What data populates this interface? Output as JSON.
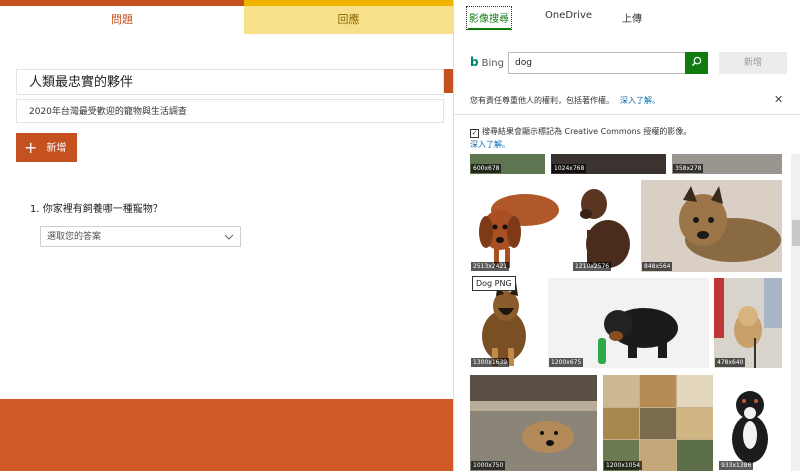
{
  "form": {
    "tabs": {
      "questions": "問題",
      "responses": "回應"
    },
    "title": "人類最忠實的夥伴",
    "subtitle": "2020年台灣最受歡迎的寵物與生活調查",
    "add_button": "新增",
    "question": "1. 你家裡有飼養哪一種寵物？",
    "select_placeholder": "選取您的答案"
  },
  "panel": {
    "tabs": [
      "影像搜尋",
      "OneDrive",
      "上傳"
    ],
    "bing_label": "Bing",
    "search_value": "dog",
    "new_button": "新增",
    "notice_text": "您有責任尊重他人的權利，包括著作權。",
    "learn_more": "深入了解。",
    "cc_text": "搜尋結果會顯示標記為 Creative Commons 授權的影像。",
    "tooltip": "Dog PNG",
    "thumbnails": [
      {
        "dims": "600x678"
      },
      {
        "dims": "1024x768"
      },
      {
        "dims": "358x278"
      },
      {
        "dims": "2513x2421"
      },
      {
        "dims": "1210x2576"
      },
      {
        "dims": "848x564"
      },
      {
        "dims": "1300x1639"
      },
      {
        "dims": "1200x675"
      },
      {
        "dims": "478x640"
      },
      {
        "dims": "1000x750"
      },
      {
        "dims": "1200x1054"
      },
      {
        "dims": "933x1386"
      }
    ]
  },
  "colors": {
    "accent": "#c4511f",
    "bing_green": "#107c10"
  }
}
